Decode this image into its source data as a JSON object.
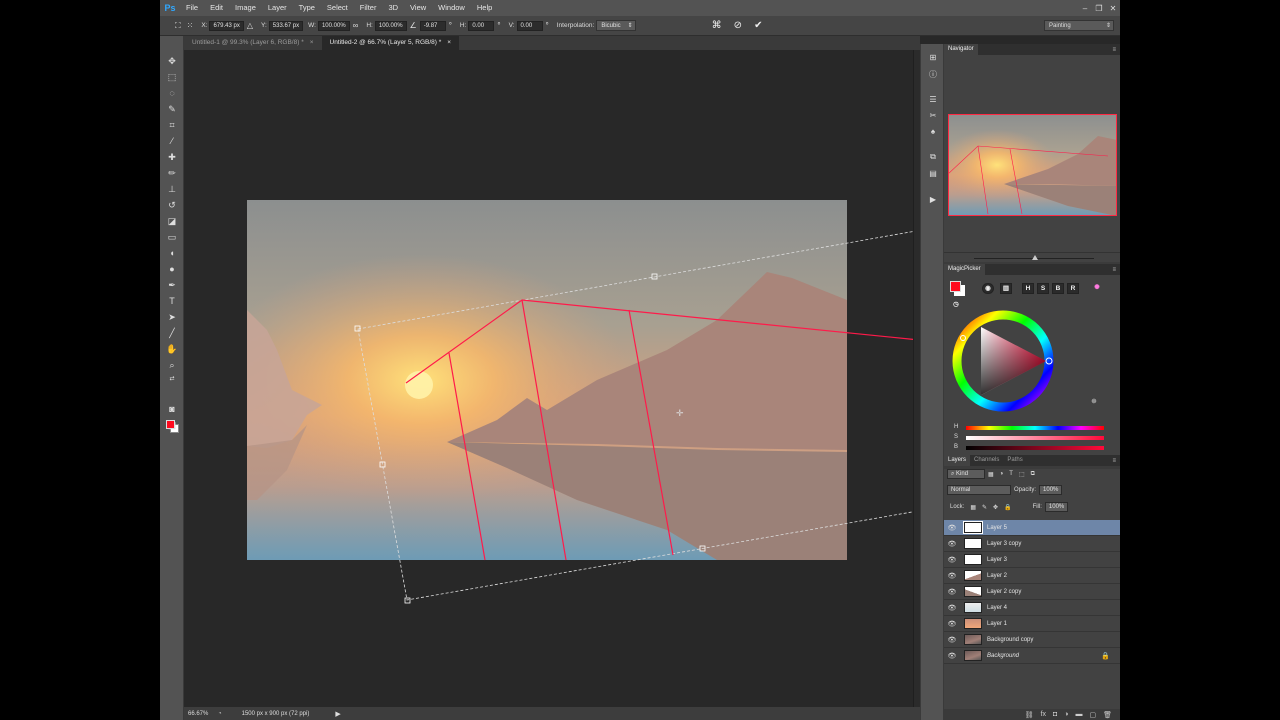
{
  "app": {
    "logo": "Ps"
  },
  "menu": [
    "File",
    "Edit",
    "Image",
    "Layer",
    "Type",
    "Select",
    "Filter",
    "3D",
    "View",
    "Window",
    "Help"
  ],
  "window_controls": {
    "minimize": "–",
    "restore": "❐",
    "close": "✕"
  },
  "options": {
    "x_label": "X:",
    "x_value": "679.43 px",
    "y_label": "Y:",
    "y_value": "533.67 px",
    "w_label": "W:",
    "w_value": "100.00%",
    "h_label": "H:",
    "h_value": "100.00%",
    "angle_value": "-9.87",
    "hskew_label": "H:",
    "hskew_value": "0.00",
    "vskew_label": "V:",
    "vskew_value": "0.00",
    "interp_label": "Interpolation:",
    "interp_value": "Bicubic",
    "workspace": "Painting"
  },
  "tabs": [
    {
      "label": "Untitled-1 @ 99.3% (Layer 6, RGB/8) *",
      "close": "×",
      "active": false
    },
    {
      "label": "Untitled-2 @ 66.7% (Layer 5, RGB/8) *",
      "close": "×",
      "active": true
    }
  ],
  "status": {
    "zoom": "66.67%",
    "doc_info": "1500 px x 900 px (72 ppi)",
    "arrow": "▶"
  },
  "panels": {
    "navigator": {
      "title": "Navigator",
      "menu": "≡"
    },
    "magicpicker": {
      "title": "MagicPicker",
      "menu": "≡",
      "buttons": [
        "H",
        "S",
        "B",
        "R"
      ]
    },
    "hsb_labels": [
      "H",
      "S",
      "B"
    ],
    "layers_tabs": [
      "Layers",
      "Channels",
      "Paths"
    ],
    "layers_menu": "≡"
  },
  "layers_panel": {
    "filter_label": "Kind",
    "blend_mode": "Normal",
    "opacity_label": "Opacity:",
    "opacity_value": "100%",
    "lock_label": "Lock:",
    "fill_label": "Fill:",
    "fill_value": "100%"
  },
  "layers": [
    {
      "name": "Layer 5",
      "selected": true
    },
    {
      "name": "Layer 3 copy",
      "selected": false
    },
    {
      "name": "Layer 3",
      "selected": false
    },
    {
      "name": "Layer 2",
      "selected": false
    },
    {
      "name": "Layer 2 copy",
      "selected": false
    },
    {
      "name": "Layer 4",
      "selected": false
    },
    {
      "name": "Layer 1",
      "selected": false
    },
    {
      "name": "Background copy",
      "selected": false
    },
    {
      "name": "Background",
      "selected": false,
      "locked": true
    }
  ],
  "colors": {
    "foreground": "#ff0a1e",
    "background": "#ffffff",
    "selection": "#6e86a8",
    "perspective_lines": "#ff1a4a"
  },
  "icons": {
    "eye": "👁",
    "lock": "🔒"
  }
}
